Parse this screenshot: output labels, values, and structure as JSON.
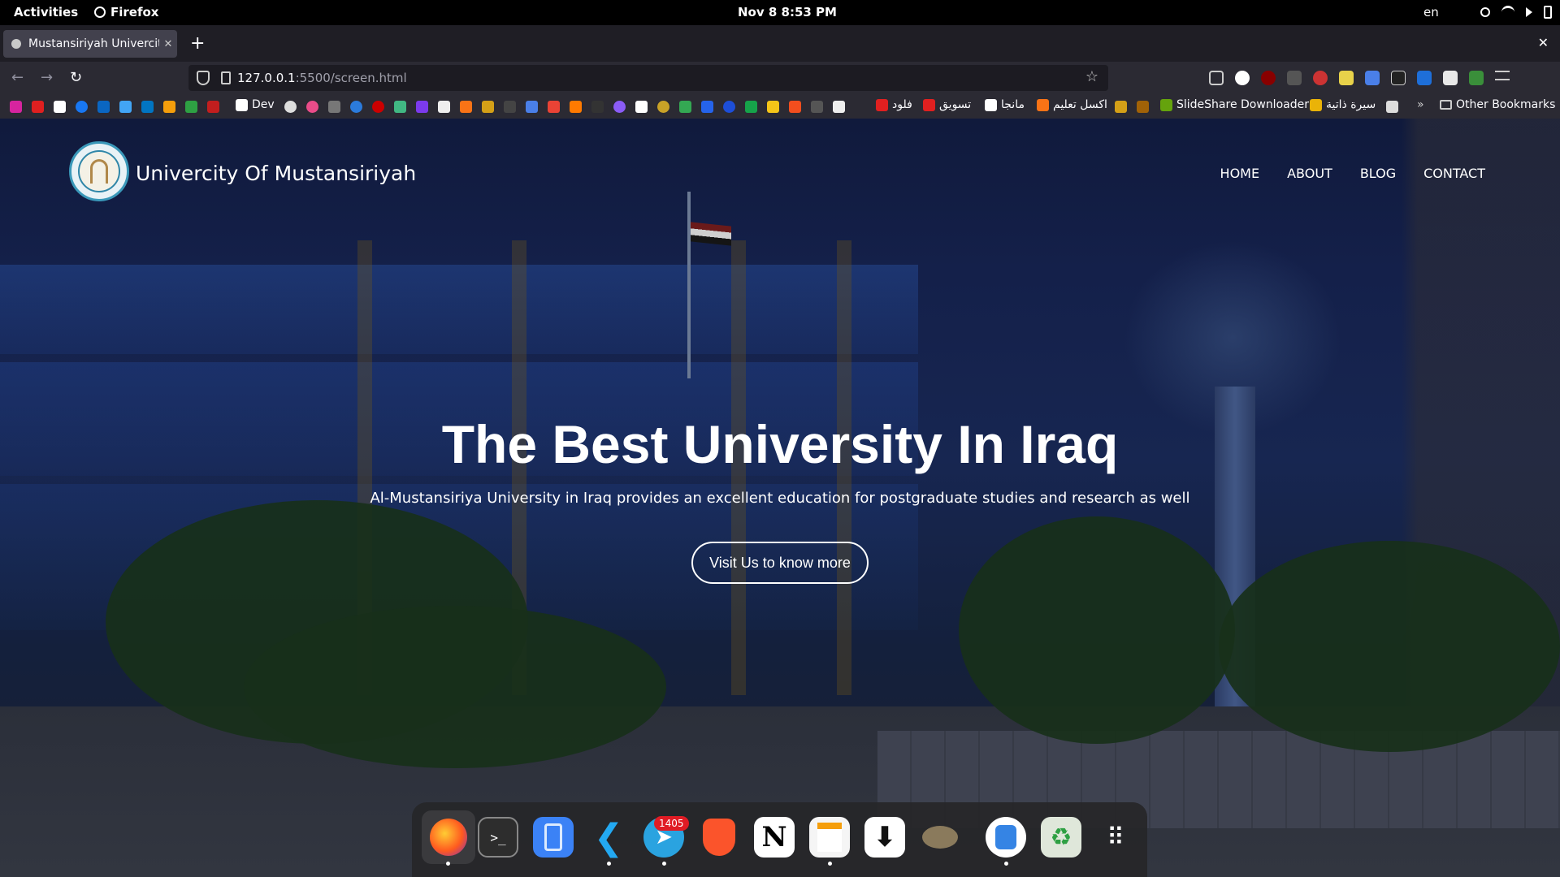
{
  "system_bar": {
    "activities": "Activities",
    "app_name": "Firefox",
    "clock": "Nov 8  8:53 PM",
    "language": "en",
    "tray_icons": [
      "brightness-icon",
      "wifi-icon",
      "volume-icon",
      "battery-icon"
    ]
  },
  "browser": {
    "tab_title": "Mustansiriyah Univercity",
    "url_host": "127.0.0.1",
    "url_path": ":5500/screen.html",
    "new_tab_symbol": "+",
    "close_tab_symbol": "✕",
    "close_window_symbol": "✕"
  },
  "bookmarks": {
    "dev_label": "Dev",
    "flood_label": "فلود",
    "marketing_label": "تسويق",
    "manga_label": "مانجا",
    "akasl_label": "اكسل تعليم",
    "slideshare_label": "SlideShare Downloader",
    "cv_label": "سيرة ذاتية",
    "other_label": "Other Bookmarks"
  },
  "site": {
    "name": "Univercity Of Mustansiriyah",
    "nav": {
      "home": "HOME",
      "about": "ABOUT",
      "blog": "BLOG",
      "contact": "CONTACT"
    },
    "hero": {
      "title": "The Best University In Iraq",
      "subtitle": "Al-Mustansiriya University in Iraq provides an excellent education for postgraduate studies and research as well",
      "button": "Visit Us to know more"
    }
  },
  "dock": {
    "telegram_badge": "1405",
    "apps": [
      "firefox-icon",
      "terminal-icon",
      "files-icon",
      "vscode-icon",
      "telegram-icon",
      "brave-icon",
      "notion-icon",
      "text-editor-icon",
      "downloader-icon",
      "gimp-icon",
      "software-icon",
      "trash-icon",
      "app-grid-icon"
    ]
  },
  "colors": {
    "topbar": "#000000",
    "tabstrip": "#1f1e25",
    "toolbar": "#2b2a33",
    "urlbar": "#1c1b22",
    "page_overlay": "#14204a",
    "badge": "#e01b24"
  }
}
